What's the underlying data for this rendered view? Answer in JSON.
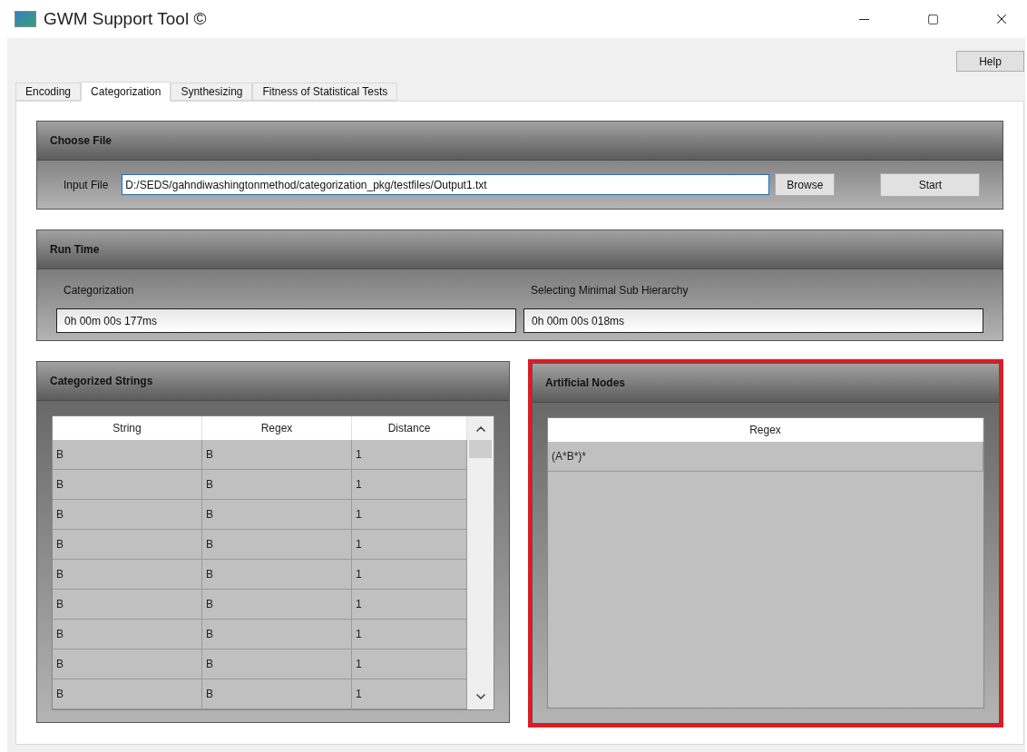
{
  "window": {
    "title": "GWM Support Tool ©"
  },
  "help_button": "Help",
  "tabs": [
    {
      "label": "Encoding",
      "selected": false
    },
    {
      "label": "Categorization",
      "selected": true
    },
    {
      "label": "Synthesizing",
      "selected": false
    },
    {
      "label": "Fitness of Statistical Tests",
      "selected": false
    }
  ],
  "choose_file": {
    "title": "Choose File",
    "input_label": "Input File",
    "input_value": "D:/SEDS/gahndiwashingtonmethod/categorization_pkg/testfiles/Output1.txt",
    "browse_button": "Browse",
    "start_button": "Start"
  },
  "run_time": {
    "title": "Run Time",
    "timers": [
      {
        "label": "Categorization",
        "value": "0h 00m 00s 177ms"
      },
      {
        "label": "Selecting Minimal Sub Hierarchy",
        "value": "0h 00m 00s 018ms"
      }
    ]
  },
  "categorized_strings": {
    "title": "Categorized Strings",
    "highlighted": false,
    "columns": [
      "String",
      "Regex",
      "Distance"
    ],
    "rows": [
      [
        "B",
        "B",
        "1"
      ],
      [
        "B",
        "B",
        "1"
      ],
      [
        "B",
        "B",
        "1"
      ],
      [
        "B",
        "B",
        "1"
      ],
      [
        "B",
        "B",
        "1"
      ],
      [
        "B",
        "B",
        "1"
      ],
      [
        "B",
        "B",
        "1"
      ],
      [
        "B",
        "B",
        "1"
      ],
      [
        "B",
        "B",
        "1"
      ]
    ]
  },
  "artificial_nodes": {
    "title": "Artificial Nodes",
    "highlighted": true,
    "columns": [
      "Regex"
    ],
    "rows": [
      [
        "(A*B*)*"
      ]
    ]
  }
}
